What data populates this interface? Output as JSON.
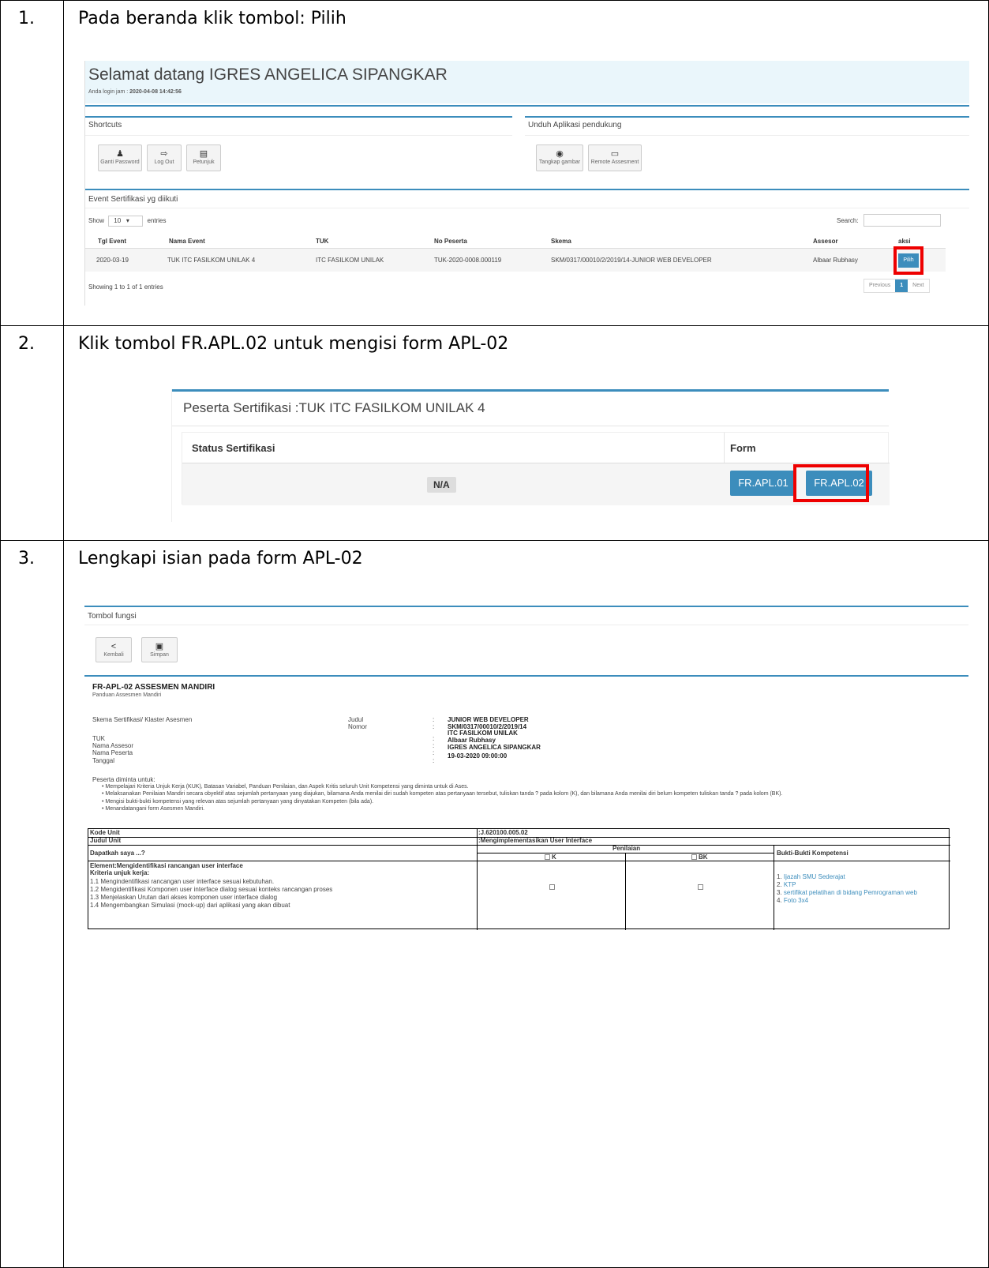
{
  "steps": [
    {
      "num": "1.",
      "title": "Pada beranda klik tombol: Pilih"
    },
    {
      "num": "2.",
      "title": "Klik tombol FR.APL.02 untuk mengisi form APL-02"
    },
    {
      "num": "3.",
      "title": "Lengkapi isian pada form APL-02"
    }
  ],
  "shot1": {
    "welcome": "Selamat datang IGRES ANGELICA SIPANGKAR",
    "login_label": "Anda login jam :",
    "login_time": "2020-04-08 14:42:56",
    "shortcuts_title": "Shortcuts",
    "shortcuts": [
      {
        "icon": "user-icon",
        "glyph": "♟",
        "label": "Ganti Password"
      },
      {
        "icon": "logout-icon",
        "glyph": "⇨",
        "label": "Log Out"
      },
      {
        "icon": "book-icon",
        "glyph": "▤",
        "label": "Petunjuk"
      }
    ],
    "download_title": "Unduh Aplikasi pendukung",
    "downloads": [
      {
        "icon": "camera-icon",
        "glyph": "◉",
        "label": "Tangkap gambar"
      },
      {
        "icon": "monitor-icon",
        "glyph": "▭",
        "label": "Remote Assesment"
      }
    ],
    "events_title": "Event Sertifikasi yg diikuti",
    "show_label": "Show",
    "show_value": "10",
    "entries_label": "entries",
    "search_label": "Search:",
    "columns": [
      "Tgl Event",
      "Nama Event",
      "TUK",
      "No Peserta",
      "Skema",
      "Assesor",
      "aksi"
    ],
    "row": [
      "2020-03-19",
      "TUK ITC FASILKOM UNILAK 4",
      "ITC FASILKOM UNILAK",
      "TUK-2020-0008.000119",
      "SKM/0317/00010/2/2019/14-JUNIOR WEB DEVELOPER",
      "Albaar Rubhasy"
    ],
    "pilih": "Pilih",
    "showing": "Showing 1 to 1 of 1 entries",
    "prev": "Previous",
    "page": "1",
    "next": "Next"
  },
  "shot2": {
    "title": "Peserta Sertifikasi :TUK ITC FASILKOM UNILAK 4",
    "status_header": "Status Sertifikasi",
    "form_header": "Form",
    "status_value": "N/A",
    "btn1": "FR.APL.01",
    "btn2": "FR.APL.02"
  },
  "shot3": {
    "tombol_fungsi": "Tombol fungsi",
    "kembali_glyph": "<",
    "kembali": "Kembali",
    "simpan_glyph": "▣",
    "simpan": "Simpan",
    "form_title": "FR-APL-02 ASSESMEN MANDIRI",
    "form_subtitle": "Panduan Assesmen Mandiri",
    "fields_left": [
      "Skema Sertifikasi/ Klaster Asesmen",
      "TUK",
      "Nama Assesor",
      "Nama Peserta",
      "Tanggal"
    ],
    "fields_mid": [
      "Judul",
      "Nomor"
    ],
    "colon": ":",
    "values": [
      "JUNIOR WEB DEVELOPER",
      "SKM/0317/00010/2/2019/14",
      "ITC FASILKOM UNILAK",
      "Albaar Rubhasy",
      "IGRES ANGELICA SIPANGKAR",
      "19-03-2020 09:00:00"
    ],
    "intro": "Peserta diminta untuk:",
    "bullets": [
      "Mempelajari Kriteria Unjuk Kerja (KUK), Batasan Variabel, Panduan Penilaian, dan Aspek Kritis seluruh Unit Kompetensi yang diminta untuk di Ases.",
      "Melaksanakan Penilaian Mandiri secara obyektif atas sejumlah pertanyaan yang diajukan, bilamana Anda menilai diri sudah kompeten atas pertanyaan tersebut, tuliskan tanda ? pada kolom (K), dan bilamana Anda menilai diri belum kompeten tuliskan tanda ? pada kolom (BK).",
      "Mengisi bukti-bukti kompetensi yang relevan atas sejumlah pertanyaan yang dinyatakan Kompeten (bila ada).",
      "Menandatangani form Asesmen Mandiri."
    ],
    "kode_unit_label": "Kode Unit",
    "kode_unit_value": ":J.620100.005.02",
    "judul_unit_label": "Judul Unit",
    "judul_unit_value": ":Mengimplementasikan User Interface",
    "dapatkah": "Dapatkah saya ...?",
    "penilaian": "Penilaian",
    "k": "K",
    "bk": "BK",
    "bukti": "Bukti-Bukti Kompetensi",
    "element": "Element:Mengidentifikasi rancangan user interface",
    "kriteria": "Kriteria unjuk kerja:",
    "kuk": [
      "1.1 Mengindentifikasi rancangan user interface sesuai kebutuhan.",
      "1.2 Mengidentifikasi Komponen user interface dialog sesuai konteks rancangan proses",
      "1.3 Menjelaskan Urutan dari akses komponen user interface dialog",
      "1.4 Mengembangkan Simulasi (mock-up) dari aplikasi yang akan dibuat"
    ],
    "evidence": [
      "Ijazah SMU Sederajat",
      "KTP",
      "sertifikat pelatihan di bidang Pemrograman web",
      "Foto 3x4"
    ],
    "evidence_nums": [
      "1.",
      "2.",
      "3.",
      "4."
    ]
  }
}
